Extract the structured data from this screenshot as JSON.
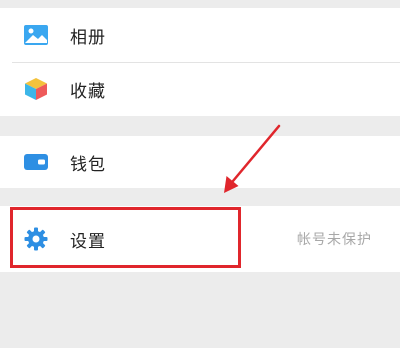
{
  "menu": {
    "album_label": "相册",
    "favorites_label": "收藏",
    "wallet_label": "钱包",
    "settings_label": "设置",
    "settings_note": "帐号未保护"
  },
  "colors": {
    "album_icon": "#3aa7f0",
    "wallet_icon": "#2e8fe3",
    "settings_icon": "#2e8fe3",
    "annotation_red": "#e0262c"
  },
  "icons": {
    "album": "image-icon",
    "favorites": "cube-icon",
    "wallet": "wallet-icon",
    "settings": "gear-icon"
  }
}
